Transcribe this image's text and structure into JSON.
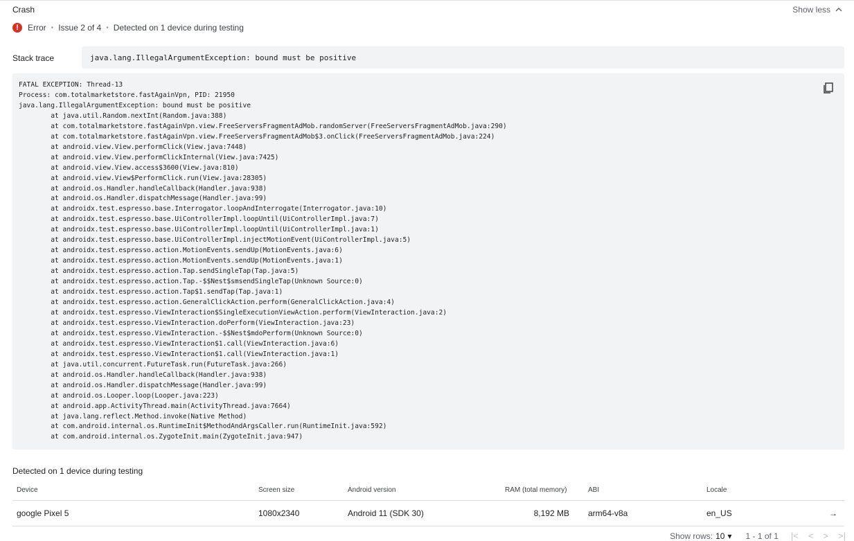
{
  "header": {
    "title": "Crash",
    "show_less": "Show less"
  },
  "issue": {
    "severity": "Error",
    "position": "Issue 2 of 4",
    "detected": "Detected on 1 device during testing",
    "severity_color": "#d93025"
  },
  "stack_trace": {
    "label": "Stack trace",
    "summary": "java.lang.IllegalArgumentException: bound must be positive",
    "full": "FATAL EXCEPTION: Thread-13\nProcess: com.totalmarketstore.fastAgainVpn, PID: 21950\njava.lang.IllegalArgumentException: bound must be positive\n\tat java.util.Random.nextInt(Random.java:388)\n\tat com.totalmarketstore.fastAgainVpn.view.FreeServersFragmentAdMob.randomServer(FreeServersFragmentAdMob.java:290)\n\tat com.totalmarketstore.fastAgainVpn.view.FreeServersFragmentAdMob$3.onClick(FreeServersFragmentAdMob.java:224)\n\tat android.view.View.performClick(View.java:7448)\n\tat android.view.View.performClickInternal(View.java:7425)\n\tat android.view.View.access$3600(View.java:810)\n\tat android.view.View$PerformClick.run(View.java:28305)\n\tat android.os.Handler.handleCallback(Handler.java:938)\n\tat android.os.Handler.dispatchMessage(Handler.java:99)\n\tat androidx.test.espresso.base.Interrogator.loopAndInterrogate(Interrogator.java:10)\n\tat androidx.test.espresso.base.UiControllerImpl.loopUntil(UiControllerImpl.java:7)\n\tat androidx.test.espresso.base.UiControllerImpl.loopUntil(UiControllerImpl.java:1)\n\tat androidx.test.espresso.base.UiControllerImpl.injectMotionEvent(UiControllerImpl.java:5)\n\tat androidx.test.espresso.action.MotionEvents.sendUp(MotionEvents.java:6)\n\tat androidx.test.espresso.action.MotionEvents.sendUp(MotionEvents.java:1)\n\tat androidx.test.espresso.action.Tap.sendSingleTap(Tap.java:5)\n\tat androidx.test.espresso.action.Tap.-$$Nest$smsendSingleTap(Unknown Source:0)\n\tat androidx.test.espresso.action.Tap$1.sendTap(Tap.java:1)\n\tat androidx.test.espresso.action.GeneralClickAction.perform(GeneralClickAction.java:4)\n\tat androidx.test.espresso.ViewInteraction$SingleExecutionViewAction.perform(ViewInteraction.java:2)\n\tat androidx.test.espresso.ViewInteraction.doPerform(ViewInteraction.java:23)\n\tat androidx.test.espresso.ViewInteraction.-$$Nest$mdoPerform(Unknown Source:0)\n\tat androidx.test.espresso.ViewInteraction$1.call(ViewInteraction.java:6)\n\tat androidx.test.espresso.ViewInteraction$1.call(ViewInteraction.java:1)\n\tat java.util.concurrent.FutureTask.run(FutureTask.java:266)\n\tat android.os.Handler.handleCallback(Handler.java:938)\n\tat android.os.Handler.dispatchMessage(Handler.java:99)\n\tat android.os.Looper.loop(Looper.java:223)\n\tat android.app.ActivityThread.main(ActivityThread.java:7664)\n\tat java.lang.reflect.Method.invoke(Native Method)\n\tat com.android.internal.os.RuntimeInit$MethodAndArgsCaller.run(RuntimeInit.java:592)\n\tat com.android.internal.os.ZygoteInit.main(ZygoteInit.java:947)",
    "copy_icon": "copy-icon"
  },
  "devices": {
    "title": "Detected on 1 device during testing",
    "columns": [
      "Device",
      "Screen size",
      "Android version",
      "RAM (total memory)",
      "ABI",
      "Locale"
    ],
    "rows": [
      {
        "device": "google Pixel 5",
        "screen_size": "1080x2340",
        "android_version": "Android 11 (SDK 30)",
        "ram": "8,192 MB",
        "abi": "arm64-v8a",
        "locale": "en_US"
      }
    ],
    "row_arrow_icon": "arrow-right-icon"
  },
  "pagination": {
    "show_rows_label": "Show rows:",
    "rows_value": "10",
    "range": "1 - 1 of 1"
  }
}
